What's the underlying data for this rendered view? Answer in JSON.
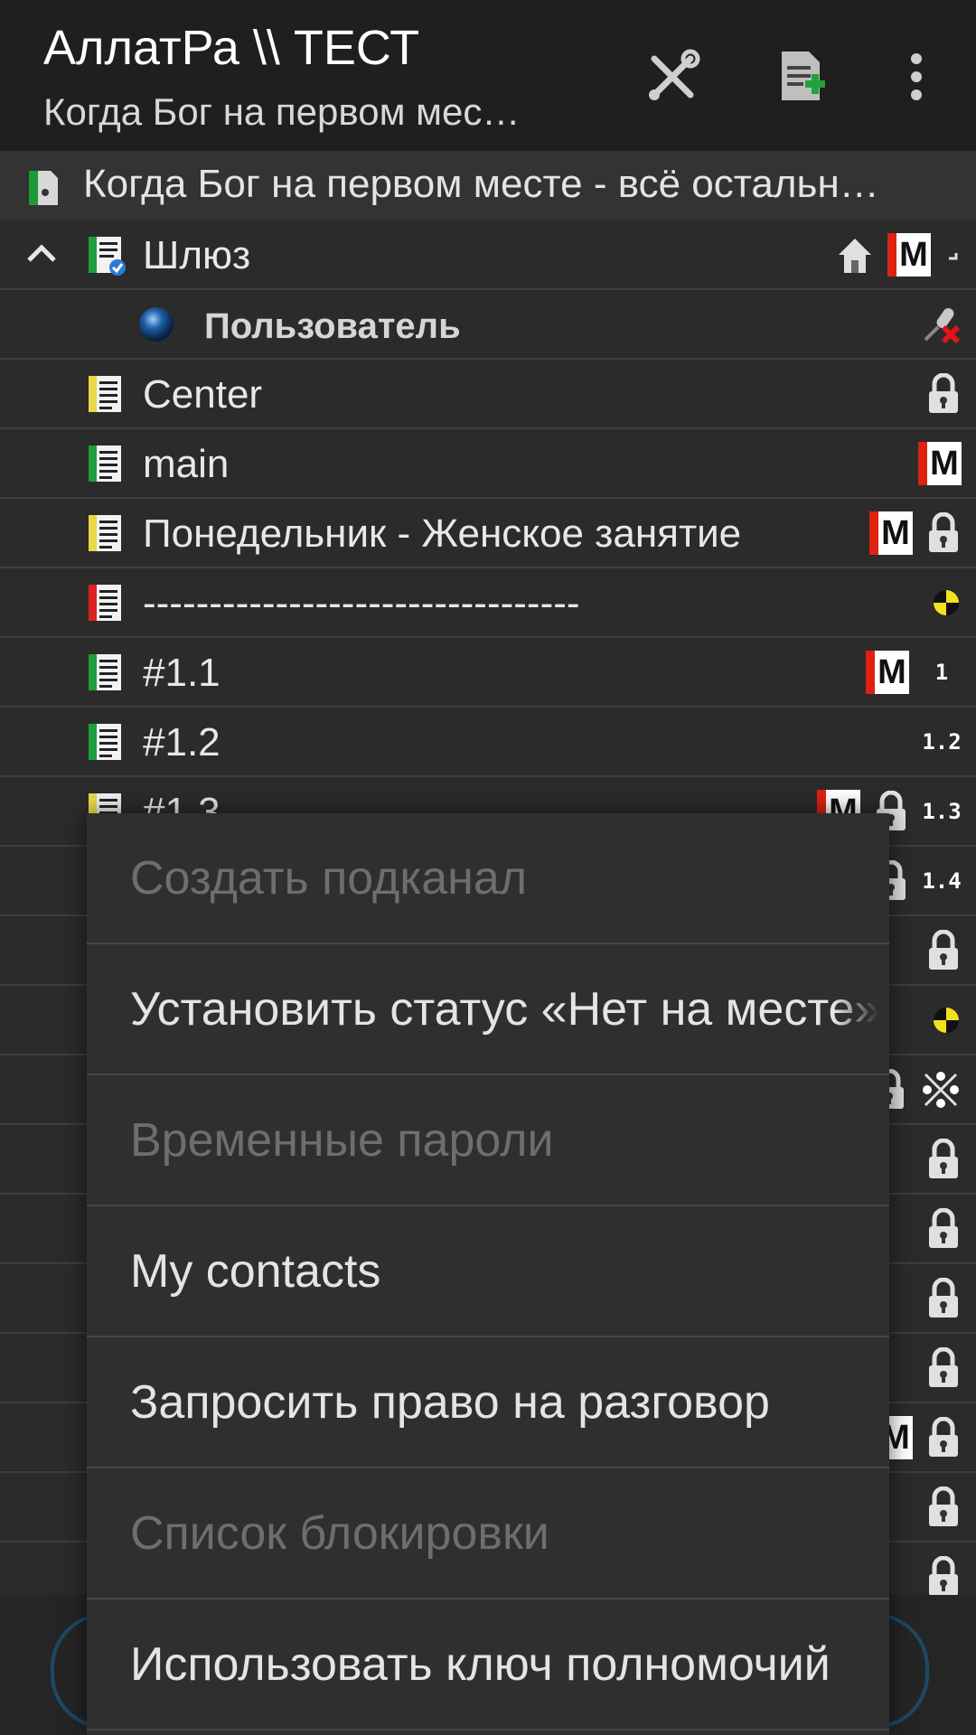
{
  "actionbar": {
    "title": "АллатРа \\\\ ТЕСТ",
    "subtitle": "Когда Бог на первом мес…",
    "icons": [
      "tools-icon",
      "add-document-icon",
      "overflow-menu-icon"
    ]
  },
  "channel_header": {
    "text": "Когда Бог на первом месте - всё остальн…"
  },
  "tree": {
    "rows": [
      {
        "label": "Шлюз",
        "icon": "channel-green-check-icon",
        "badges": [
          "home-icon",
          "moderated-icon",
          "corner-icon"
        ]
      },
      {
        "label": "Пользователь",
        "icon": "user-sphere-icon",
        "badges": [
          "muted-mic-icon"
        ]
      },
      {
        "label": "Center",
        "icon": "channel-yellow-icon",
        "badges": [
          "lock-icon"
        ]
      },
      {
        "label": "main",
        "icon": "channel-green-icon",
        "badges": [
          "moderated-icon"
        ]
      },
      {
        "label": "Понедельник - Женское занятие",
        "icon": "channel-yellow-icon",
        "badges": [
          "moderated-icon",
          "lock-icon"
        ]
      },
      {
        "label": "---------------------------------",
        "icon": "channel-red-icon",
        "badges": [
          "yellow-dot-icon"
        ]
      },
      {
        "label": "#1.1",
        "icon": "channel-green-icon",
        "badges": [
          "moderated-icon"
        ],
        "tag": "1"
      },
      {
        "label": "#1.2",
        "icon": "channel-green-icon",
        "badges": [],
        "tag": "1.2"
      },
      {
        "label": "#1.3",
        "icon": "channel-yellow-icon",
        "badges": [
          "moderated-icon",
          "lock-icon"
        ],
        "tag": "1.3"
      },
      {
        "label": "",
        "icon": "",
        "badges": [
          "lock-icon"
        ],
        "tag": "1.4"
      },
      {
        "label": "",
        "icon": "",
        "badges": [
          "lock-icon"
        ]
      },
      {
        "label": "",
        "icon": "",
        "badges": [
          "yellow-dot-icon"
        ]
      },
      {
        "label": "",
        "icon": "",
        "badges": [
          "lock-icon",
          "dots-icon"
        ]
      },
      {
        "label": "",
        "icon": "",
        "badges": [
          "lock-icon"
        ]
      },
      {
        "label": "",
        "icon": "",
        "badges": [
          "lock-icon"
        ]
      },
      {
        "label": "",
        "icon": "",
        "badges": [
          "lock-icon"
        ]
      },
      {
        "label": "",
        "icon": "",
        "badges": [
          "lock-icon"
        ]
      },
      {
        "label": "",
        "icon": "",
        "badges": [
          "moderated-icon",
          "lock-icon"
        ]
      },
      {
        "label": "",
        "icon": "",
        "badges": [
          "lock-icon"
        ]
      },
      {
        "label": "",
        "icon": "",
        "badges": [
          "lock-icon"
        ]
      }
    ]
  },
  "context_menu": {
    "items": [
      {
        "label": "Создать подканал",
        "enabled": false
      },
      {
        "label": "Установить статус «Нет на месте»",
        "enabled": true
      },
      {
        "label": "Временные пароли",
        "enabled": false
      },
      {
        "label": "My contacts",
        "enabled": true
      },
      {
        "label": "Запросить право на разговор",
        "enabled": true
      },
      {
        "label": "Список блокировки",
        "enabled": false
      },
      {
        "label": "Использовать ключ полномочий",
        "enabled": true
      }
    ]
  },
  "colors": {
    "actionbar_bg": "#1f1f1f",
    "list_bg": "#2b2b2b",
    "menu_bg": "#2f2f2f",
    "disabled_text": "#6e6e6e",
    "moderated_red": "#d21"
  }
}
